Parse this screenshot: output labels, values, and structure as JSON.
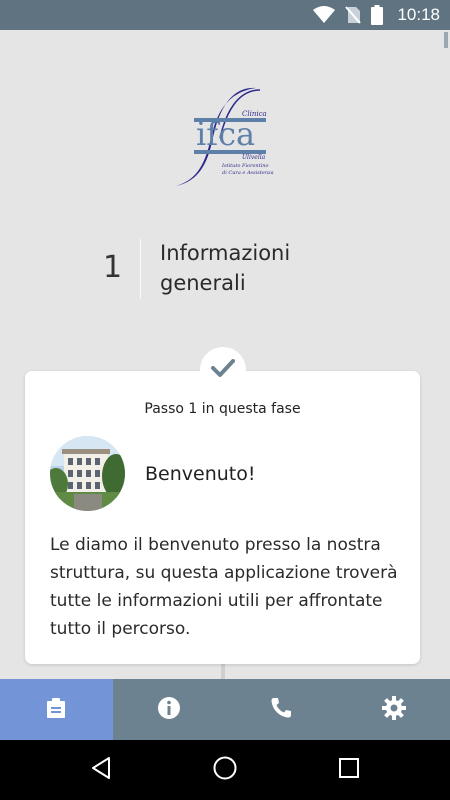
{
  "status_bar": {
    "time": "10:18",
    "icons": [
      "wifi-icon",
      "no-sim-icon",
      "battery-icon"
    ]
  },
  "logo": {
    "name": "ifca-logo",
    "brand_text": "ifca",
    "small_text_top": "Clinica",
    "small_text_mid": "Ulivella",
    "subtitle_lines": [
      "Istituto Fiorentino",
      "di Cura e Assistenza"
    ]
  },
  "section": {
    "number": "1",
    "title": "Informazioni generali"
  },
  "card": {
    "step_label": "Passo 1 in questa fase",
    "title": "Benvenuto!",
    "body": "Le diamo il benvenuto presso la nostra struttura, su questa applicazione troverà tutte le informazioni utili per affrontate tutto il percorso."
  },
  "tabs": [
    {
      "icon": "clipboard-icon",
      "active": true
    },
    {
      "icon": "info-icon",
      "active": false
    },
    {
      "icon": "phone-icon",
      "active": false
    },
    {
      "icon": "gear-icon",
      "active": false
    }
  ],
  "nav": [
    "back-icon",
    "home-icon",
    "recents-icon"
  ],
  "colors": {
    "status_bar": "#5f7480",
    "tab_bar": "#6d8290",
    "tab_active": "#7394d6",
    "background": "#e5e5e5",
    "check": "#6d8290"
  }
}
